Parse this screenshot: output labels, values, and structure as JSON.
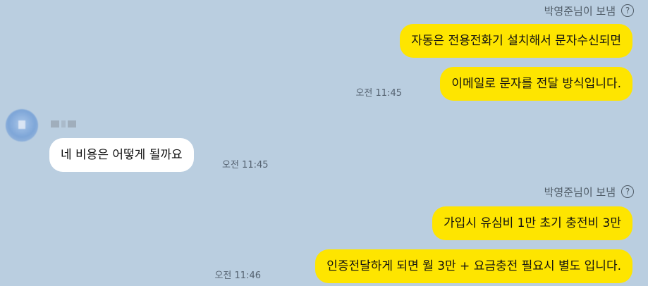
{
  "messages": [
    {
      "sender_label": "박영준님이 보냄"
    },
    {
      "text": "자동은 전용전화기 설치해서 문자수신되면"
    },
    {
      "text": "이메일로 문자를 전달 방식입니다.",
      "time": "오전 11:45"
    },
    {
      "text": "네 비용은 어떻게 될까요",
      "time": "오전 11:45"
    },
    {
      "sender_label": "박영준님이 보냄"
    },
    {
      "text": "가입시 유심비 1만 초기 충전비 3만"
    },
    {
      "text": "인증전달하게 되면 월 3만 + 요금충전 필요시 별도 입니다.",
      "time": "오전 11:46"
    }
  ],
  "icons": {
    "help": "?"
  },
  "colors": {
    "background": "#bacee0",
    "my_bubble": "#fee500",
    "other_bubble": "#ffffff"
  }
}
